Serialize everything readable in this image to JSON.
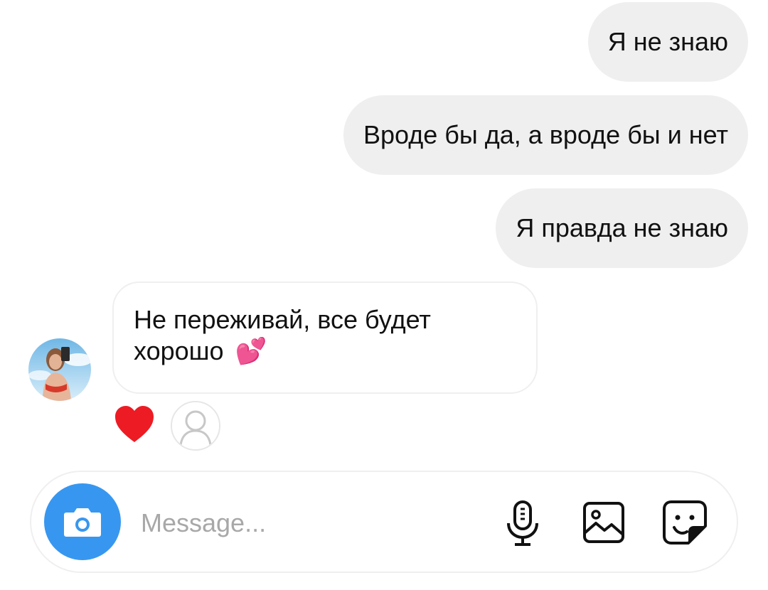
{
  "chat": {
    "messages": [
      {
        "direction": "outgoing",
        "text": "Я не знаю"
      },
      {
        "direction": "outgoing",
        "text": "Вроде бы да, а вроде бы и нет"
      },
      {
        "direction": "outgoing",
        "text": "Я правда не знаю"
      },
      {
        "direction": "incoming",
        "text": "Не переживай, все будет хорошо",
        "emoji": "💕"
      }
    ],
    "reactions": [
      {
        "icon": "heart-icon",
        "color": "#ed1b24"
      }
    ]
  },
  "composer": {
    "placeholder": "Message...",
    "value": ""
  },
  "colors": {
    "outgoing_bubble": "#efefef",
    "accent_blue": "#3797f0",
    "reaction_red": "#ed1b24",
    "placeholder": "#a8a8a8"
  },
  "icons": [
    "camera-icon",
    "microphone-icon",
    "gallery-icon",
    "sticker-icon"
  ]
}
